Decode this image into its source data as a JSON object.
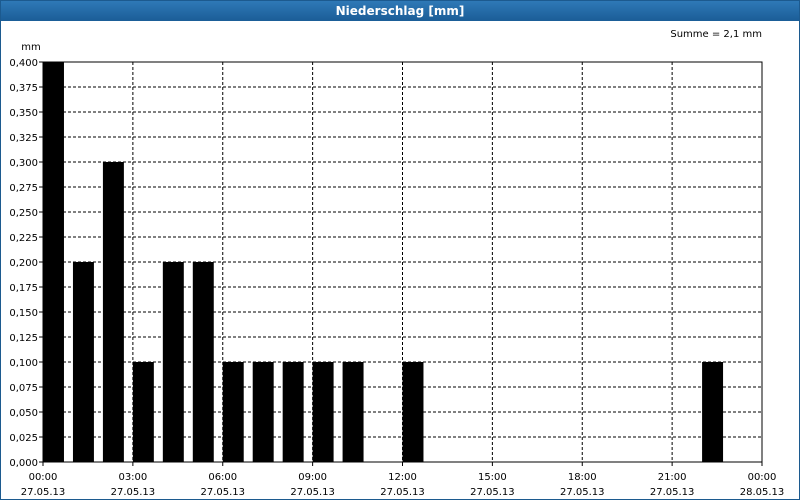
{
  "window": {
    "title": "Niederschlag [mm]"
  },
  "chart_data": {
    "type": "bar",
    "title": "Niederschlag [mm]",
    "ylabel": "mm",
    "summary": "Summe = 2,1 mm",
    "ylim": [
      0,
      0.4
    ],
    "yticks": [
      "0,000",
      "0,025",
      "0,050",
      "0,075",
      "0,100",
      "0,125",
      "0,150",
      "0,175",
      "0,200",
      "0,225",
      "0,250",
      "0,275",
      "0,300",
      "0,325",
      "0,350",
      "0,375",
      "0,400"
    ],
    "xticks": [
      {
        "time": "00:00",
        "date": "27.05.13"
      },
      {
        "time": "03:00",
        "date": "27.05.13"
      },
      {
        "time": "06:00",
        "date": "27.05.13"
      },
      {
        "time": "09:00",
        "date": "27.05.13"
      },
      {
        "time": "12:00",
        "date": "27.05.13"
      },
      {
        "time": "15:00",
        "date": "27.05.13"
      },
      {
        "time": "18:00",
        "date": "27.05.13"
      },
      {
        "time": "21:00",
        "date": "27.05.13"
      },
      {
        "time": "00:00",
        "date": "28.05.13"
      }
    ],
    "x_range_hours": [
      0,
      24
    ],
    "bar_width_hours": 0.7,
    "bars": [
      {
        "hour": 0.0,
        "value": 0.4
      },
      {
        "hour": 1.0,
        "value": 0.2
      },
      {
        "hour": 2.0,
        "value": 0.3
      },
      {
        "hour": 3.0,
        "value": 0.1
      },
      {
        "hour": 4.0,
        "value": 0.2
      },
      {
        "hour": 5.0,
        "value": 0.2
      },
      {
        "hour": 6.0,
        "value": 0.1
      },
      {
        "hour": 7.0,
        "value": 0.1
      },
      {
        "hour": 8.0,
        "value": 0.1
      },
      {
        "hour": 9.0,
        "value": 0.1
      },
      {
        "hour": 10.0,
        "value": 0.1
      },
      {
        "hour": 12.0,
        "value": 0.1
      },
      {
        "hour": 22.0,
        "value": 0.1
      }
    ],
    "bar_color": "#000000",
    "grid": true
  }
}
